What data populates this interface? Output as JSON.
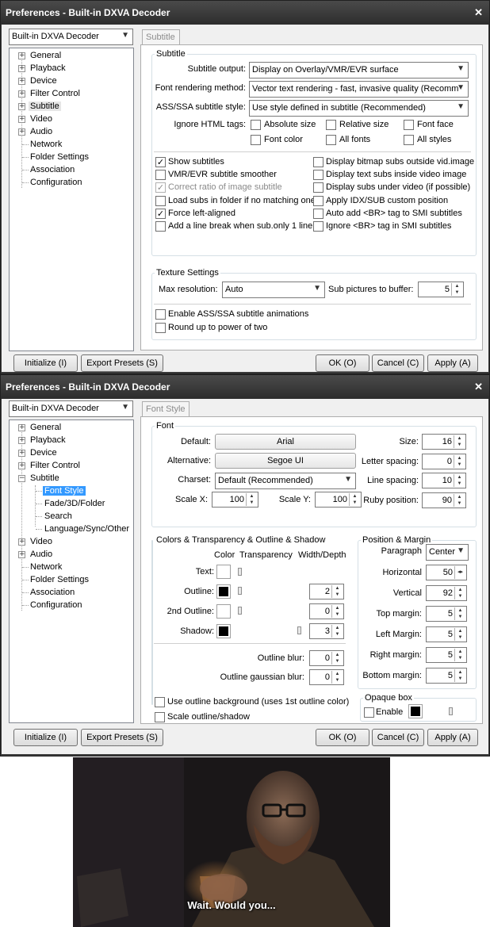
{
  "window_title": "Preferences - Built-in DXVA Decoder",
  "filter_select": "Built-in DXVA Decoder",
  "buttons": {
    "initialize": "Initialize (I)",
    "export": "Export Presets (S)",
    "ok": "OK (O)",
    "cancel": "Cancel (C)",
    "apply": "Apply (A)"
  },
  "tree1": [
    "General",
    "Playback",
    "Device",
    "Filter Control",
    "Subtitle",
    "Video",
    "Audio",
    "Network",
    "Folder Settings",
    "Association",
    "Configuration"
  ],
  "tree2": [
    "General",
    "Playback",
    "Device",
    "Filter Control",
    "Subtitle",
    "Font Style",
    "Fade/3D/Folder",
    "Search",
    "Language/Sync/Other",
    "Video",
    "Audio",
    "Network",
    "Folder Settings",
    "Association",
    "Configuration"
  ],
  "sub": {
    "tab": "Subtitle",
    "group": "Subtitle",
    "output_label": "Subtitle output:",
    "output_value": "Display on Overlay/VMR/EVR surface",
    "font_label": "Font rendering method:",
    "font_value": "Vector text rendering - fast, invasive quality (Recomm",
    "ass_label": "ASS/SSA subtitle style:",
    "ass_value": "Use style defined in subtitle (Recommended)",
    "html_label": "Ignore HTML tags:",
    "html_opts": [
      "Absolute size",
      "Relative size",
      "Font face",
      "Font color",
      "All fonts",
      "All styles"
    ],
    "left_checks": [
      "Show subtitles",
      "VMR/EVR subtitle smoother",
      "Correct ratio of image subtitle",
      "Load subs in folder if no matching one",
      "Force left-aligned",
      "Add a line break when sub.only 1 line"
    ],
    "right_checks": [
      "Display bitmap subs outside vid.image",
      "Display text subs inside video image",
      "Display subs under video (if possible)",
      "Apply IDX/SUB custom position",
      "Auto add <BR> tag to SMI subtitles",
      "Ignore <BR> tag in SMI subtitles"
    ],
    "texture_group": "Texture Settings",
    "maxres_label": "Max resolution:",
    "maxres_value": "Auto",
    "buffer_label": "Sub pictures to buffer:",
    "buffer_value": "5",
    "ass_anim": "Enable ASS/SSA subtitle animations",
    "round_pow": "Round up to power of two"
  },
  "font": {
    "tab": "Font Style",
    "group": "Font",
    "default_label": "Default:",
    "default_value": "Arial",
    "alt_label": "Alternative:",
    "alt_value": "Segoe UI",
    "charset_label": "Charset:",
    "charset_value": "Default (Recommended)",
    "scalex_label": "Scale X:",
    "scalex_value": "100",
    "scaley_label": "Scale Y:",
    "scaley_value": "100",
    "size_label": "Size:",
    "size_value": "16",
    "letter_label": "Letter spacing:",
    "letter_value": "0",
    "line_label": "Line spacing:",
    "line_value": "10",
    "ruby_label": "Ruby position:",
    "ruby_value": "90",
    "colors_group": "Colors & Transparency & Outline & Shadow",
    "col_color": "Color",
    "col_trans": "Transparency",
    "col_width": "Width/Depth",
    "text_label": "Text:",
    "outline_label": "Outline:",
    "outline_value": "2",
    "outline2_label": "2nd Outline:",
    "outline2_value": "0",
    "shadow_label": "Shadow:",
    "shadow_value": "3",
    "blur_label": "Outline blur:",
    "blur_value": "0",
    "gblur_label": "Outline gaussian blur:",
    "gblur_value": "0",
    "use_outline_bg": "Use outline background (uses 1st outline color)",
    "scale_outline": "Scale outline/shadow",
    "pos_group": "Position & Margin",
    "para_label": "Paragraph",
    "para_value": "Center",
    "horiz_label": "Horizontal",
    "horiz_value": "50",
    "vert_label": "Vertical",
    "vert_value": "92",
    "top_label": "Top margin:",
    "top_value": "5",
    "left_label": "Left Margin:",
    "left_value": "5",
    "right_label": "Right margin:",
    "right_value": "5",
    "bottom_label": "Bottom margin:",
    "bottom_value": "5",
    "opaque_group": "Opaque box",
    "enable_label": "Enable"
  },
  "video_subtitle": "Wait. Would you..."
}
